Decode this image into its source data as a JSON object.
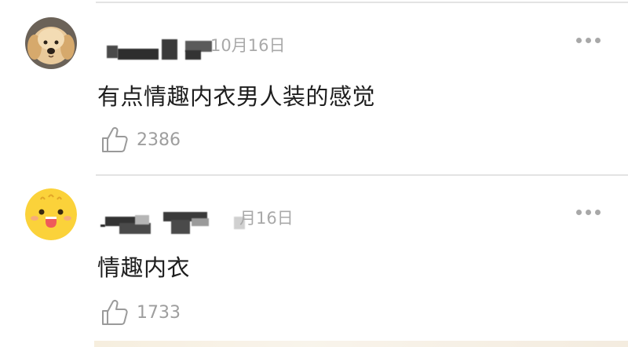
{
  "comments": [
    {
      "avatar": "dog-avatar",
      "username": "",
      "date": "10月16日",
      "more_icon": "more-dots-icon",
      "text": "有点情趣内衣男人装的感觉",
      "like_icon": "thumbs-up-icon",
      "likes": "2386"
    },
    {
      "avatar": "emoji-face-avatar",
      "username": "",
      "date": "月16日",
      "more_icon": "more-dots-icon",
      "text": "情趣内衣",
      "like_icon": "thumbs-up-icon",
      "likes": "1733"
    }
  ],
  "colors": {
    "divider": "#e3e3e3",
    "date": "#a9a9a9",
    "like_count": "#9e9e9e",
    "text": "#1e1e1e"
  }
}
